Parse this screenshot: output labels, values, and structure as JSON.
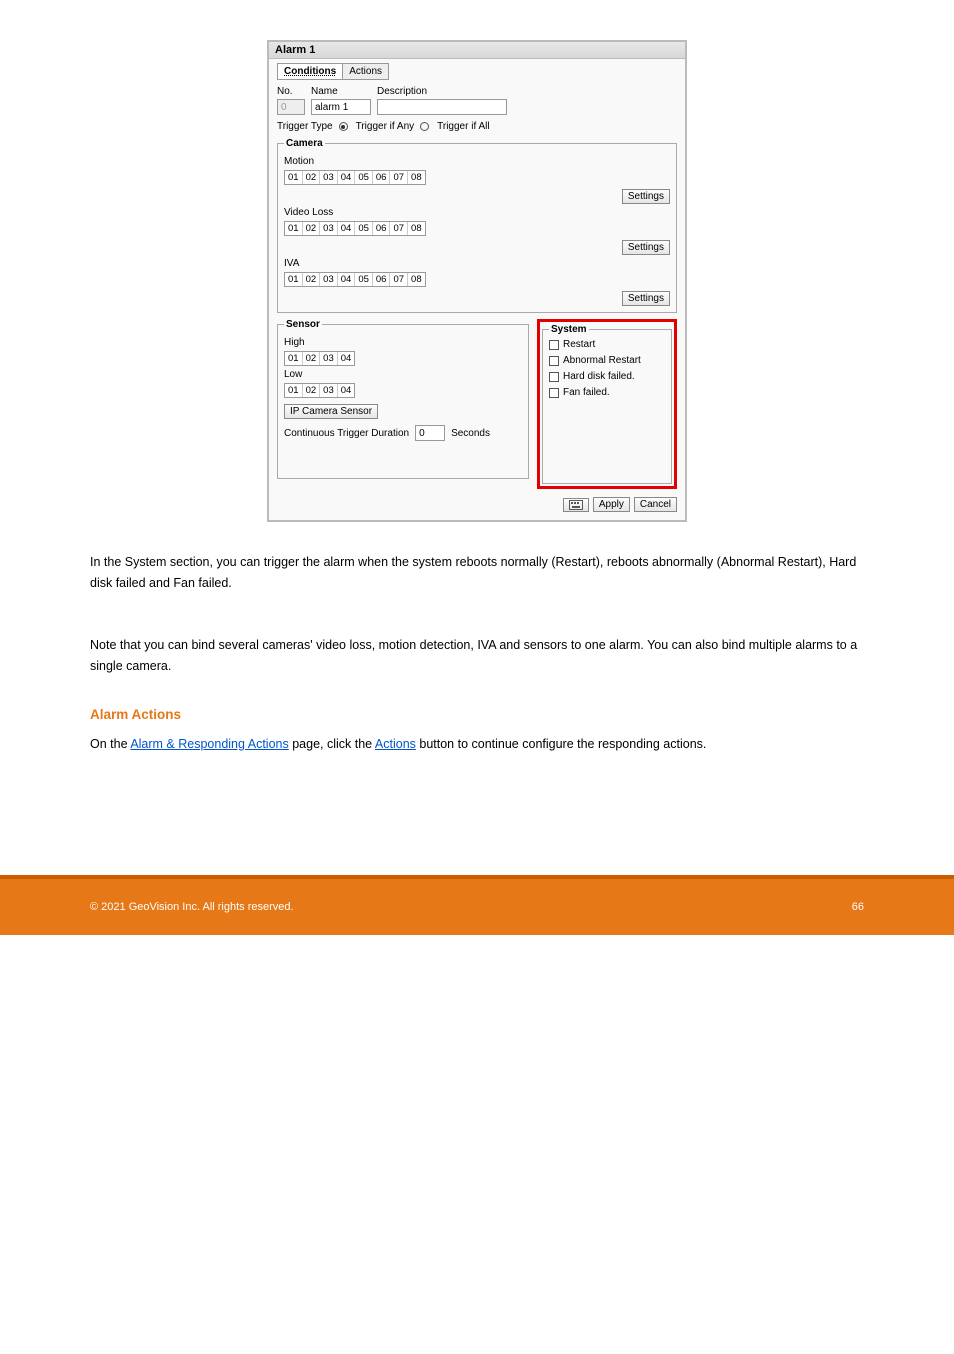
{
  "dialog": {
    "title": "Alarm 1",
    "tabs": {
      "conditions": "Conditions",
      "actions": "Actions"
    },
    "fields": {
      "no_label": "No.",
      "no_value": "0",
      "name_label": "Name",
      "name_value": "alarm 1",
      "desc_label": "Description",
      "desc_value": ""
    },
    "trigger": {
      "label": "Trigger Type",
      "opt_any": "Trigger if Any",
      "opt_all": "Trigger if All"
    },
    "camera": {
      "legend": "Camera",
      "motion": "Motion",
      "video_loss": "Video Loss",
      "iva": "IVA",
      "nums8": [
        "01",
        "02",
        "03",
        "04",
        "05",
        "06",
        "07",
        "08"
      ],
      "settings": "Settings"
    },
    "sensor": {
      "legend": "Sensor",
      "high": "High",
      "low": "Low",
      "nums4": [
        "01",
        "02",
        "03",
        "04"
      ],
      "ip_sensor": "IP Camera Sensor",
      "ctd_label": "Continuous Trigger Duration",
      "ctd_value": "0",
      "ctd_unit": "Seconds"
    },
    "system": {
      "legend": "System",
      "restart": "Restart",
      "abnormal": "Abnormal Restart",
      "hdd": "Hard disk failed.",
      "fan": "Fan failed."
    },
    "footer": {
      "apply": "Apply",
      "cancel": "Cancel"
    }
  },
  "body": {
    "p1": "In the System section, you can trigger the alarm when the system reboots normally (Restart), reboots abnormally (Abnormal Restart), Hard disk failed and Fan failed.",
    "p2": "Note that you can bind several cameras' video loss, motion detection, IVA and sensors to one alarm. You can also bind multiple alarms to a single camera.",
    "subhead": "Alarm Actions",
    "p3_a": "On the ",
    "p3_link": "Alarm & Responding Actions",
    "p3_b": " page, click the ",
    "p3_c": " button to continue configure the responding actions."
  },
  "footer_band": {
    "copyright": "© 2021 GeoVision Inc. All rights reserved.",
    "page": "66"
  }
}
